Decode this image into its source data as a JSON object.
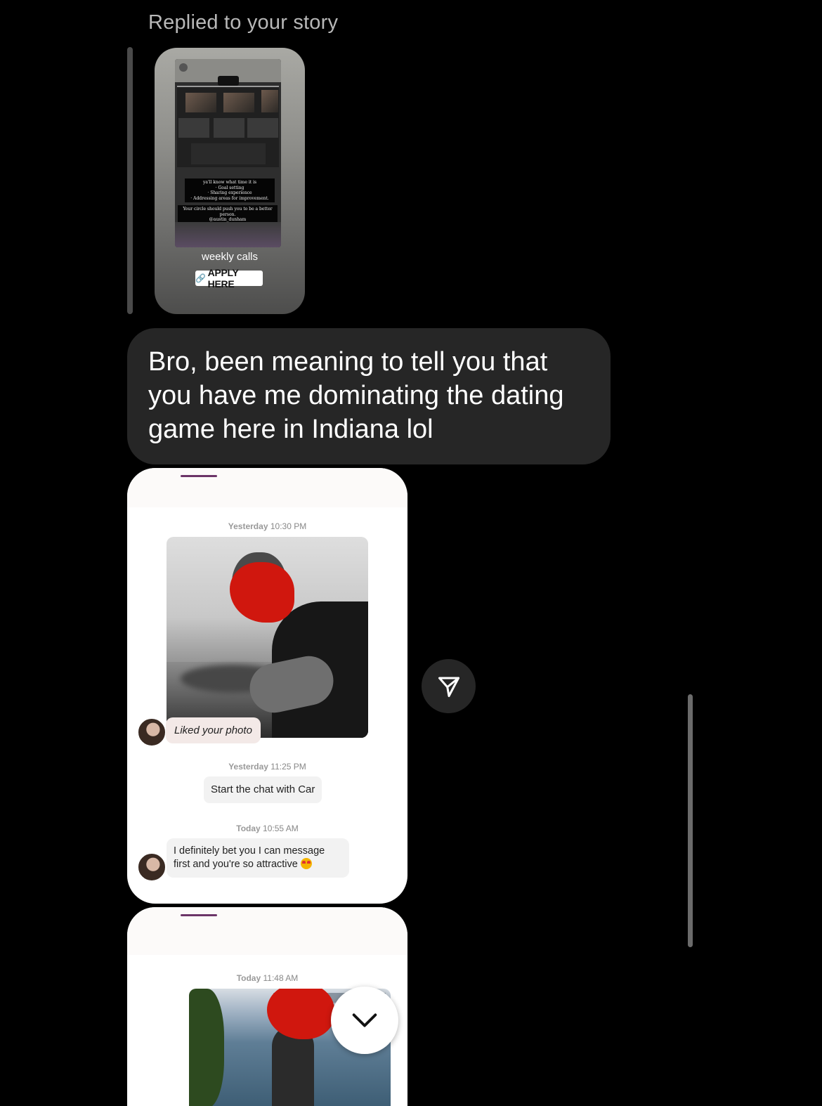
{
  "reply_header": {
    "label": "Replied to your story"
  },
  "story": {
    "caption_lines": [
      "ya'll know what time it is",
      "· Goal setting",
      "· Sharing experience",
      "· Addressing areas for improvement."
    ],
    "caption2_lines": [
      "Your circle should push you to be a better",
      "person.",
      "@austin_dunham"
    ],
    "weekly_calls": "weekly calls",
    "apply_label": "APPLY HERE"
  },
  "message": {
    "text": "Bro, been meaning to tell you that you have me dominating the dating game here in Indiana lol"
  },
  "screenshot_1": {
    "stamp1_day": "Yesterday",
    "stamp1_time": "10:30 PM",
    "liked_label": "Liked your photo",
    "stamp2_day": "Yesterday",
    "stamp2_time": "11:25 PM",
    "start_chat": "Start the chat with Car",
    "stamp3_day": "Today",
    "stamp3_time": "10:55 AM",
    "incoming_message": "I definitely bet you I can message first and you're so attractive"
  },
  "screenshot_2": {
    "stamp_day": "Today",
    "stamp_time": "11:48 AM"
  },
  "icons": {
    "share": "paper-plane-icon",
    "scroll_down": "chevron-down-icon",
    "link": "link-icon"
  },
  "colors": {
    "background": "#000000",
    "bubble": "#262626",
    "accent_purple": "#6c3468",
    "redaction": "#d0170e"
  }
}
